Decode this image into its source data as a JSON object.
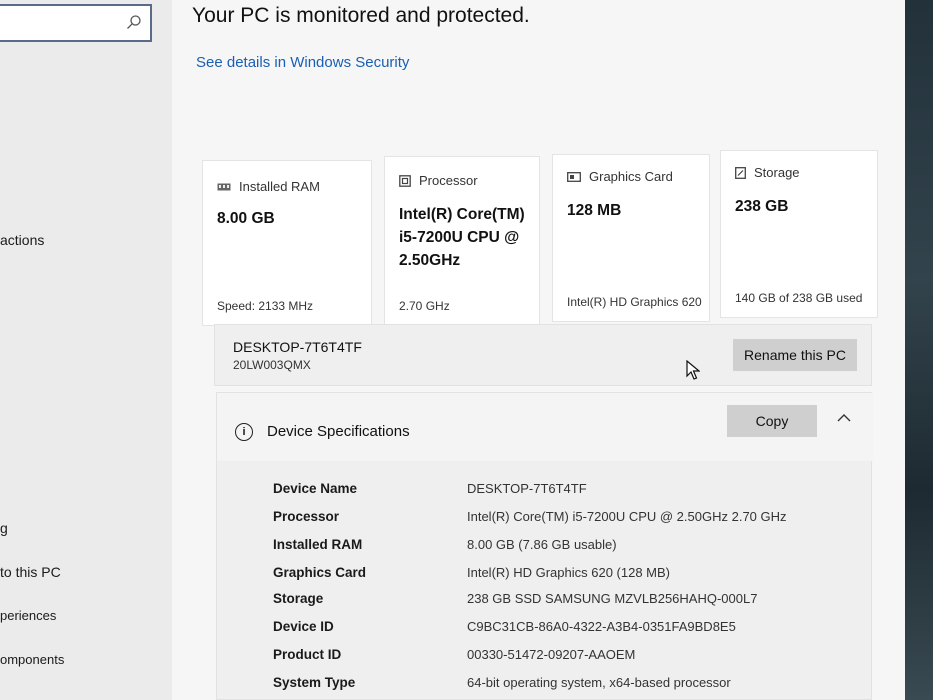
{
  "sidebar": {
    "items": [
      {
        "label": "actions"
      },
      {
        "label": "g"
      },
      {
        "label": "to this PC"
      },
      {
        "label": "periences"
      },
      {
        "label": "omponents"
      }
    ]
  },
  "main": {
    "headline": "Your PC is monitored and protected.",
    "security_link": "See details in Windows Security",
    "cards": [
      {
        "title": "Installed RAM",
        "icon": "ram-icon",
        "value": "8.00 GB",
        "footer": "Speed: 2133 MHz"
      },
      {
        "title": "Processor",
        "icon": "processor-icon",
        "value": "Intel(R) Core(TM) i5-7200U CPU @ 2.50GHz",
        "footer": "2.70 GHz"
      },
      {
        "title": "Graphics Card",
        "icon": "graphics-card-icon",
        "value": "128 MB",
        "footer": "Intel(R) HD Graphics 620"
      },
      {
        "title": "Storage",
        "icon": "storage-icon",
        "value": "238 GB",
        "footer": "140 GB of 238 GB used"
      }
    ],
    "pc": {
      "name": "DESKTOP-7T6T4TF",
      "model": "20LW003QMX",
      "rename_label": "Rename this PC"
    },
    "specs": {
      "title": "Device Specifications",
      "copy_label": "Copy",
      "rows": [
        {
          "label": "Device Name",
          "value": "DESKTOP-7T6T4TF"
        },
        {
          "label": "Processor",
          "value": "Intel(R) Core(TM) i5-7200U CPU @ 2.50GHz   2.70 GHz"
        },
        {
          "label": "Installed RAM",
          "value": "8.00 GB (7.86 GB usable)"
        },
        {
          "label": "Graphics Card",
          "value": "Intel(R) HD Graphics 620 (128 MB)"
        },
        {
          "label": "Storage",
          "value": "238 GB SSD SAMSUNG MZVLB256HAHQ-000L7"
        },
        {
          "label": "Device ID",
          "value": "C9BC31CB-86A0-4322-A3B4-0351FA9BD8E5"
        },
        {
          "label": "Product ID",
          "value": "00330-51472-09207-AAOEM"
        },
        {
          "label": "System Type",
          "value": "64-bit operating system, x64-based processor"
        }
      ]
    }
  },
  "colors": {
    "link": "#1a5fb4",
    "button": "#cfcfcf"
  }
}
